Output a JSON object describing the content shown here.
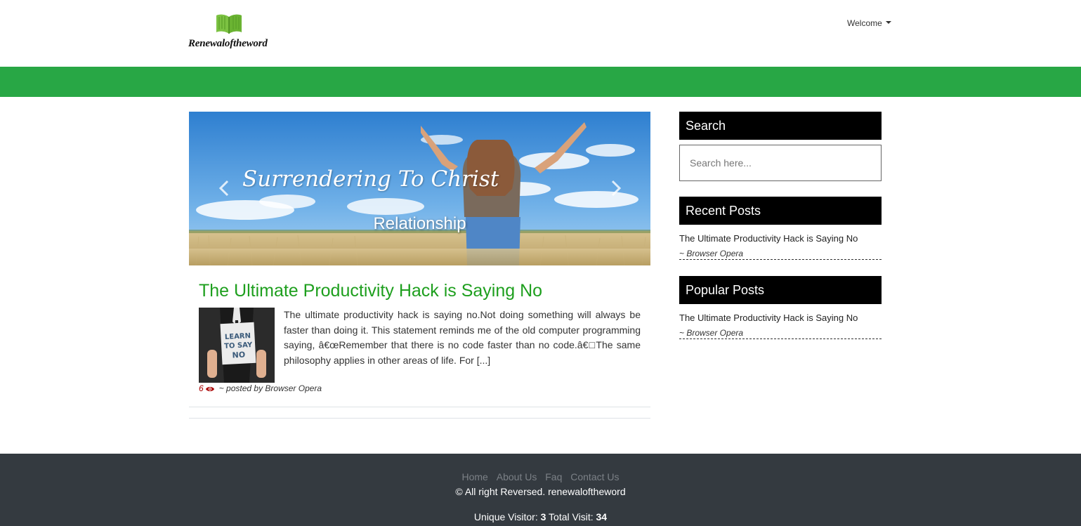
{
  "header": {
    "logo_text": "Renewaloftheword",
    "welcome_label": "Welcome"
  },
  "carousel": {
    "headline": "Surrendering To Christ",
    "caption": "Relationship"
  },
  "post": {
    "title": "The Ultimate Productivity Hack is Saying No",
    "excerpt": "The ultimate productivity hack is saying no.Not doing something will always be faster than doing it. This statement reminds me of the old computer programming saying, â€œRemember that there is no code faster than no code.â€□The same philosophy applies in other areas of life. For [...]",
    "thumb_sign_text": "LEARN TO SAY NO",
    "views": "6",
    "byline": "~ posted by Browser Opera"
  },
  "sidebar": {
    "search_heading": "Search",
    "search_placeholder": "Search here...",
    "recent_heading": "Recent Posts",
    "recent_posts": [
      {
        "title": "The Ultimate Productivity Hack is Saying No",
        "author": "~ Browser Opera"
      }
    ],
    "popular_heading": "Popular Posts",
    "popular_posts": [
      {
        "title": "The Ultimate Productivity Hack is Saying No",
        "author": "~ Browser Opera"
      }
    ]
  },
  "footer": {
    "links": [
      "Home",
      "About Us",
      "Faq",
      "Contact Us"
    ],
    "copyright": "© All right Reversed. renewaloftheword",
    "unique_label": "Unique Visitor:",
    "unique_value": "3",
    "total_label": "Total Visit:",
    "total_value": "34"
  },
  "colors": {
    "brand_green": "#28a745",
    "title_green": "#1e9f1e",
    "footer_bg": "#343a40"
  }
}
